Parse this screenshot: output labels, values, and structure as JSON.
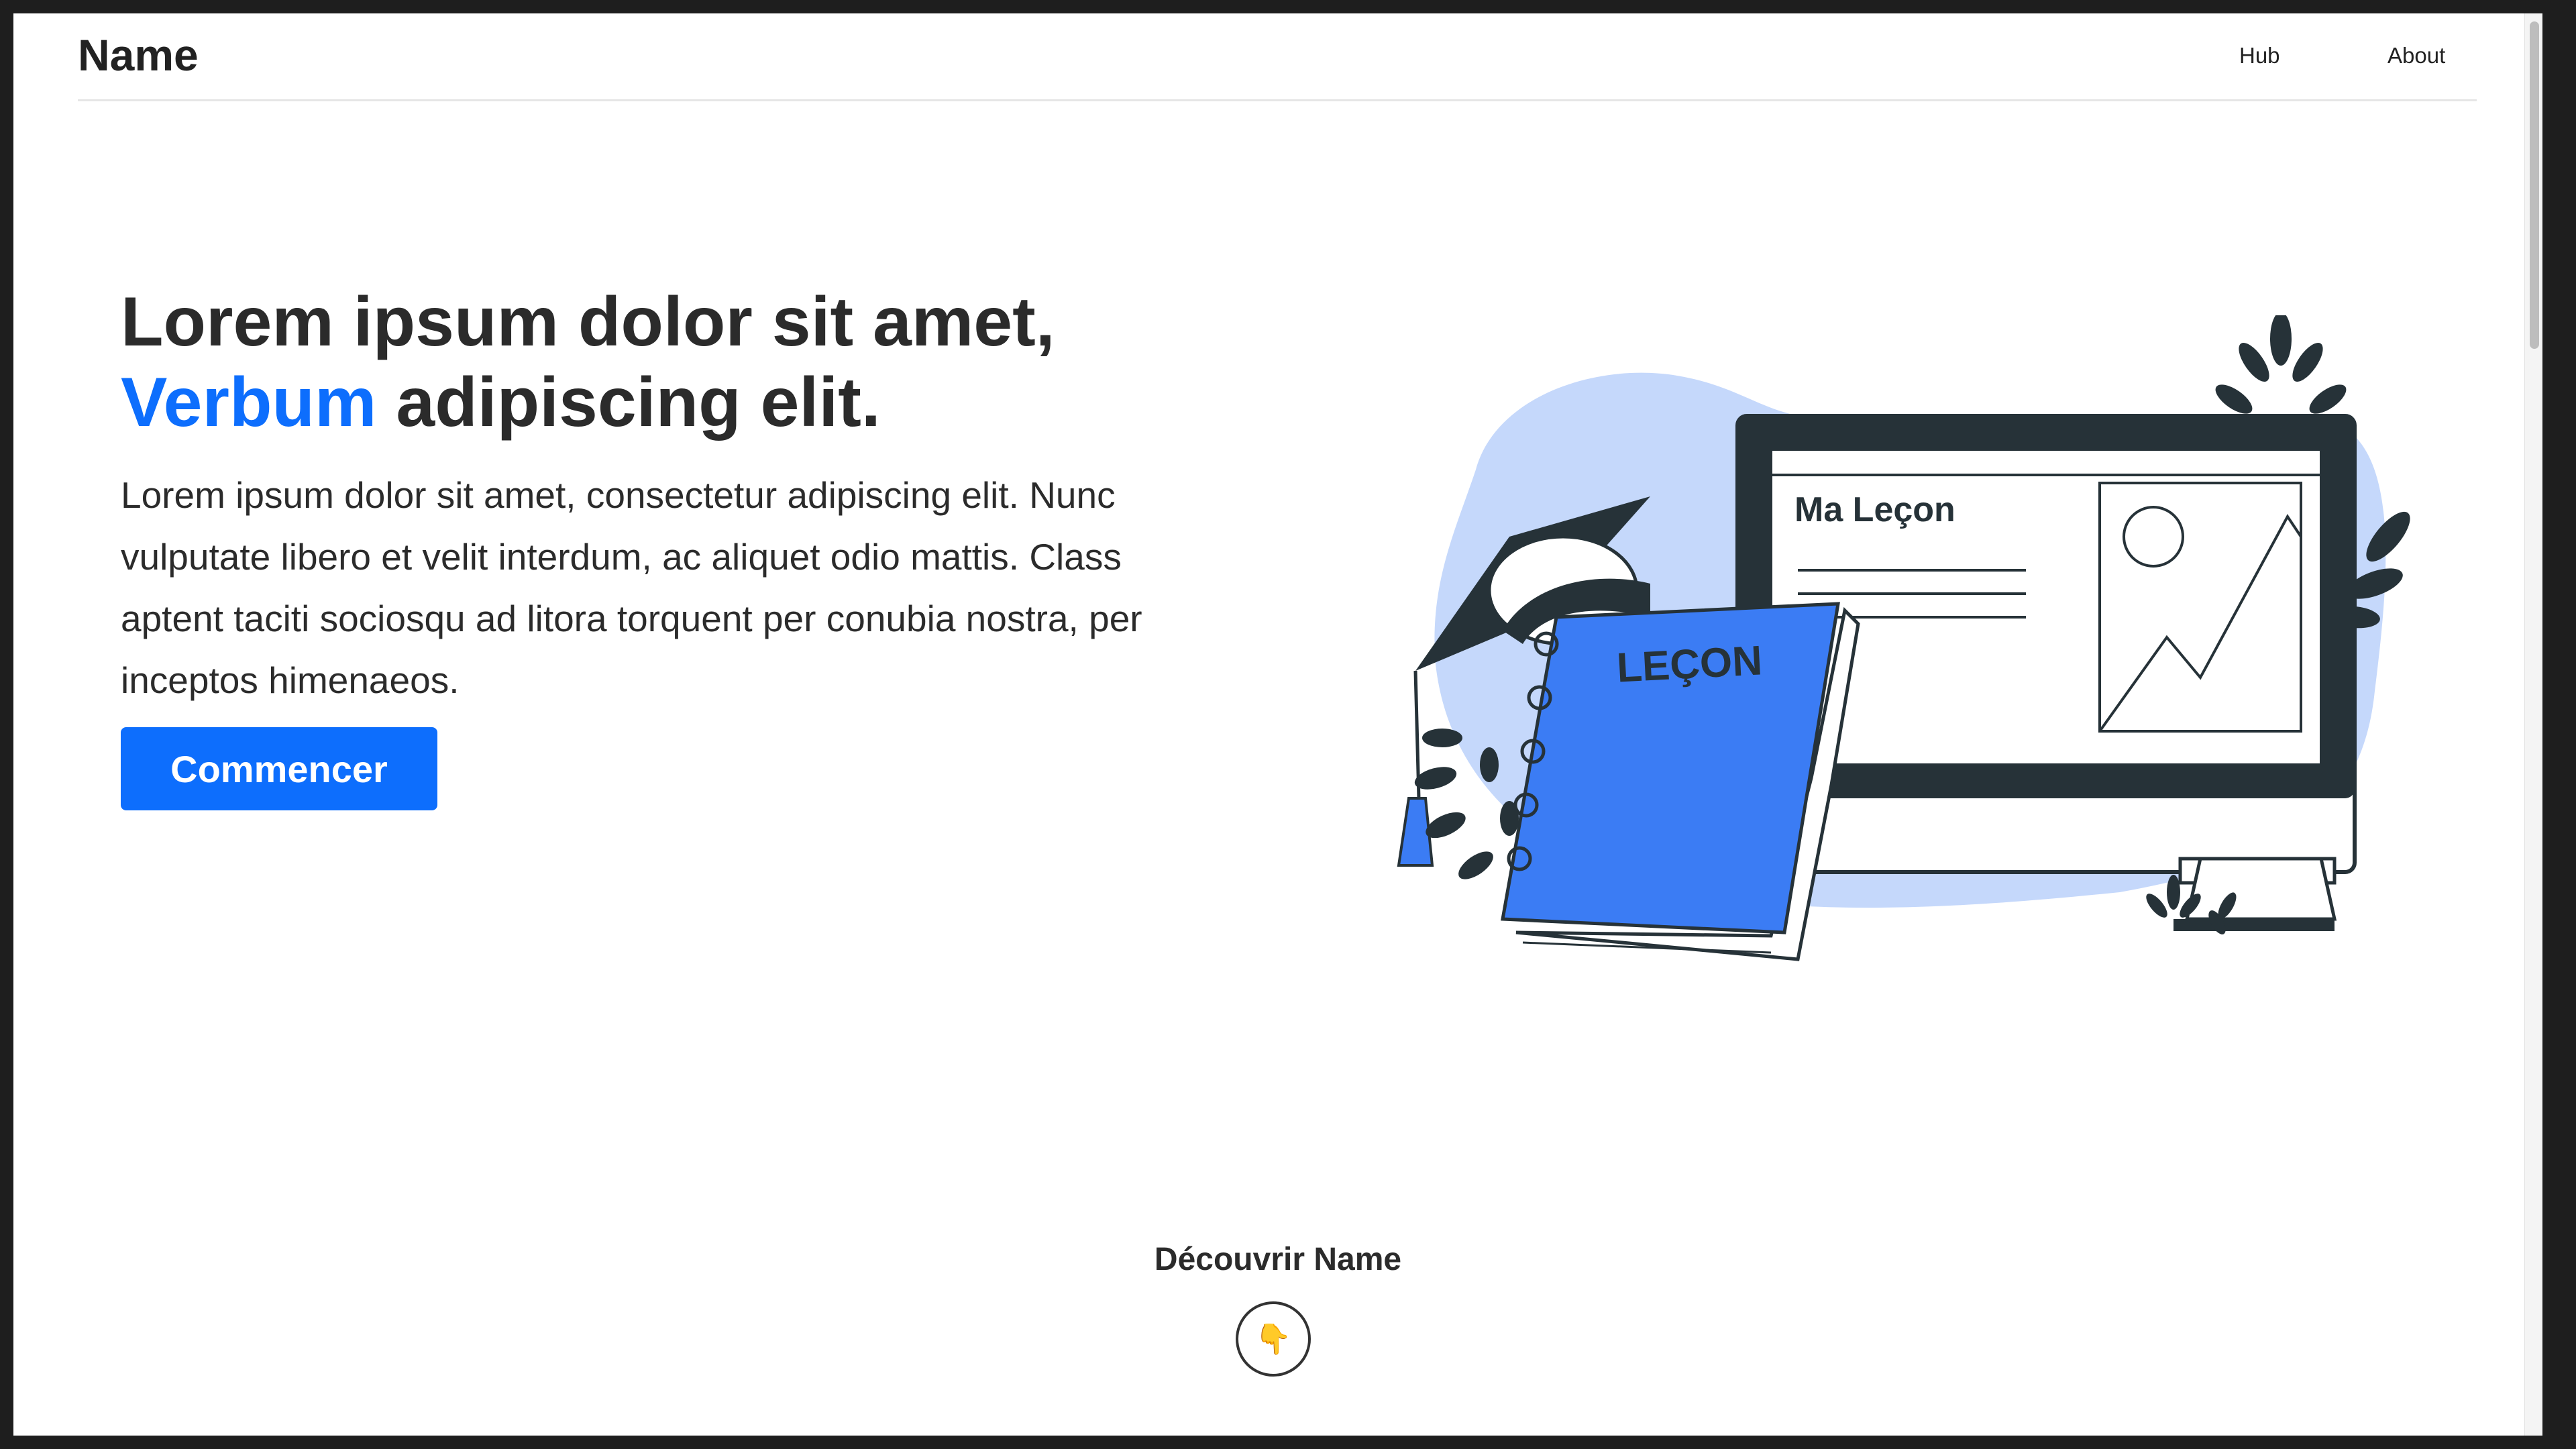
{
  "navbar": {
    "brand": "Name",
    "links": [
      "Hub",
      "About"
    ]
  },
  "hero": {
    "title_line1": "Lorem ipsum dolor sit amet,",
    "title_accent": "Verbum",
    "title_line2_rest": "adipiscing elit.",
    "paragraph": "Lorem ipsum dolor sit amet, consectetur adipiscing elit. Nunc vulputate libero et velit interdum, ac aliquet odio mattis. Class aptent taciti sociosqu ad litora torquent per conubia nostra, per inceptos himenaeos.",
    "cta_label": "Commencer"
  },
  "illustration": {
    "screen_title": "Ma Leçon",
    "book_title": "LEÇON"
  },
  "discover": {
    "label": "Découvrir Name",
    "button_icon": "👇",
    "button_icon_name": "pointing-down-icon"
  },
  "colors": {
    "accent": "#0d6efd",
    "book_blue": "#3b7cf4",
    "blob": "#c5d8fb",
    "dark": "#263238"
  }
}
